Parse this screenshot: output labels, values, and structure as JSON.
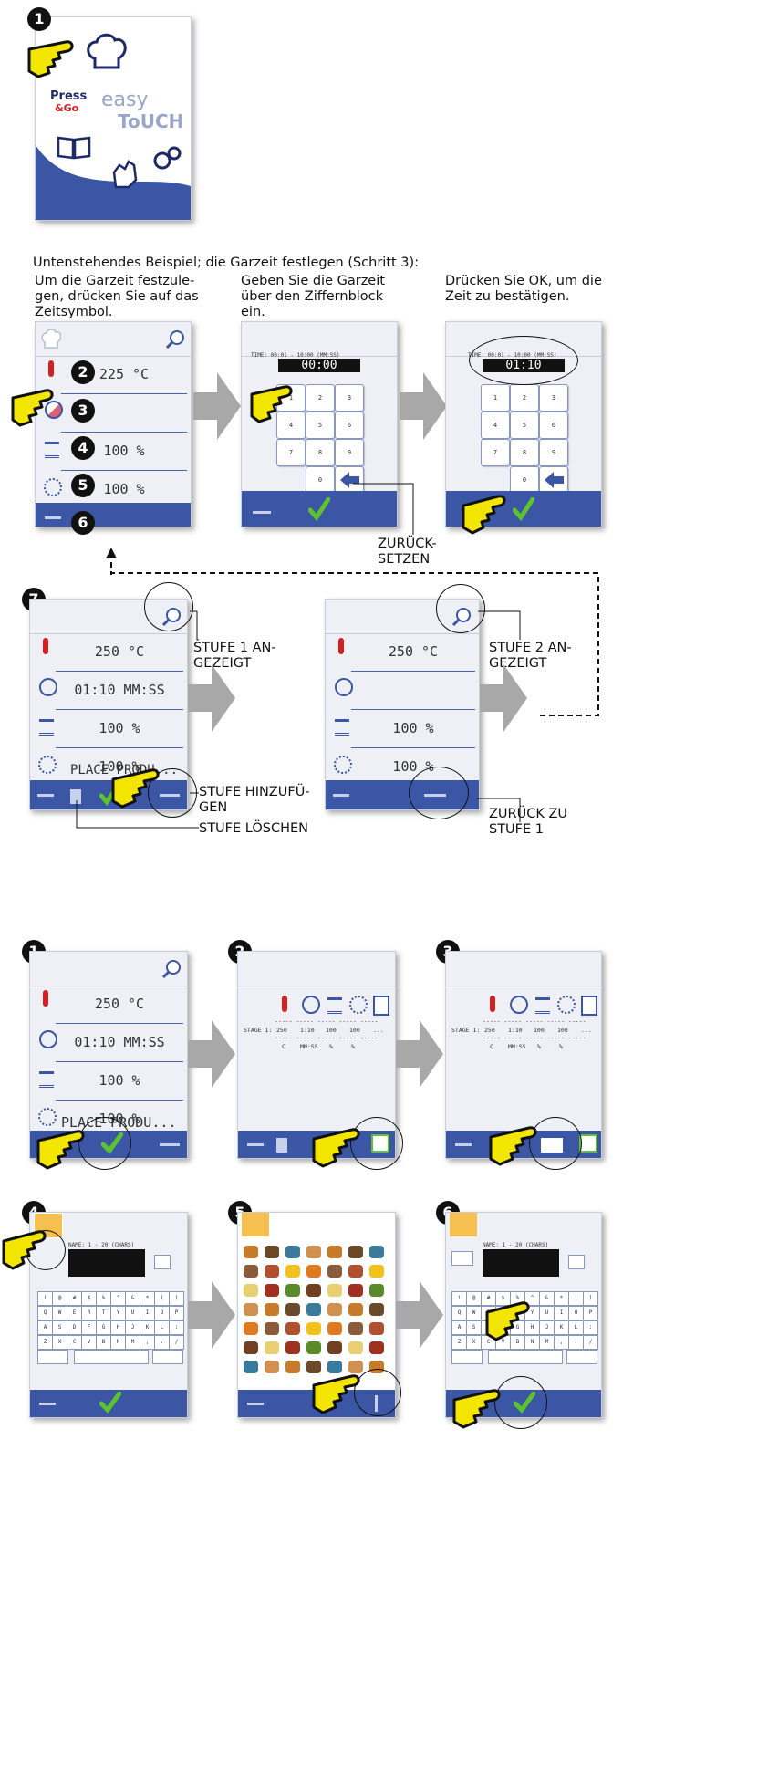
{
  "step_numbers": [
    "1",
    "2",
    "3",
    "4",
    "5",
    "6",
    "7"
  ],
  "home": {
    "press_go_line1": "Press",
    "press_go_line2": "&Go",
    "easy": "easy",
    "touch": "ToUCH"
  },
  "intro": "Untenstehendes Beispiel; die Garzeit festlegen (Schritt 3):",
  "captions": {
    "c1": [
      "Um die Garzeit festzule-",
      "gen, drücken Sie auf das",
      "Zeitsymbol."
    ],
    "c2": [
      "Geben Sie die Garzeit",
      "über den Ziffernblock",
      "ein."
    ],
    "c3": [
      "Drücken Sie OK, um die",
      "Zeit zu bestätigen."
    ]
  },
  "settings_screen": {
    "temp": "225 °C",
    "fan1": "100 %",
    "fan2": "100 %"
  },
  "keypad": {
    "header": "TIME: 00:01 - 10:00 (MM:SS)",
    "display_a": "00:00",
    "display_b": "01:10",
    "keys": [
      "1",
      "2",
      "3",
      "4",
      "5",
      "6",
      "7",
      "8",
      "9",
      "0"
    ]
  },
  "labels": {
    "reset": [
      "ZURÜCK-",
      "SETZEN"
    ],
    "stage1_shown": [
      "STUFE 1 AN-",
      "GEZEIGT"
    ],
    "stage2_shown": [
      "STUFE 2 AN-",
      "GEZEIGT"
    ],
    "add_stage": [
      "STUFE HINZUFÜ-",
      "GEN"
    ],
    "delete_stage": "STUFE LÖSCHEN",
    "back_stage1": [
      "ZURÜCK ZU",
      "STUFE 1"
    ]
  },
  "stage_screen": {
    "temp": "250 °C",
    "time": "01:10 MM:SS",
    "steam": "100 %",
    "fan": "100 %",
    "note": "PLACE PRODU...",
    "note_long": "PLACE PRODU..."
  },
  "table_screen": {
    "row_label": "STAGE 1:",
    "values": [
      "250",
      "1:10",
      "100",
      "100",
      "..."
    ],
    "units": [
      "C",
      "MM:SS",
      "%",
      "%"
    ],
    "dashes": "----- ----- ----- ----- -----"
  },
  "name_screen": {
    "header": "NAME: 1 - 20 (CHARS)",
    "row1": [
      "!",
      "@",
      "#",
      "$",
      "%",
      "^",
      "&",
      "*",
      "(",
      ")"
    ],
    "row2": [
      "Q",
      "W",
      "E",
      "R",
      "T",
      "Y",
      "U",
      "I",
      "O",
      "P"
    ],
    "row3": [
      "A",
      "S",
      "D",
      "F",
      "G",
      "H",
      "J",
      "K",
      "L",
      ":"
    ],
    "row4": [
      "Z",
      "X",
      "C",
      "V",
      "B",
      "N",
      "M",
      ",",
      ".",
      "/"
    ]
  },
  "colors": {
    "accent": "#3a56a4",
    "thermometer": "#d42020",
    "hand": "#f2e600",
    "check": "#5cc22e",
    "arrow_gray": "#a8a8a8"
  }
}
